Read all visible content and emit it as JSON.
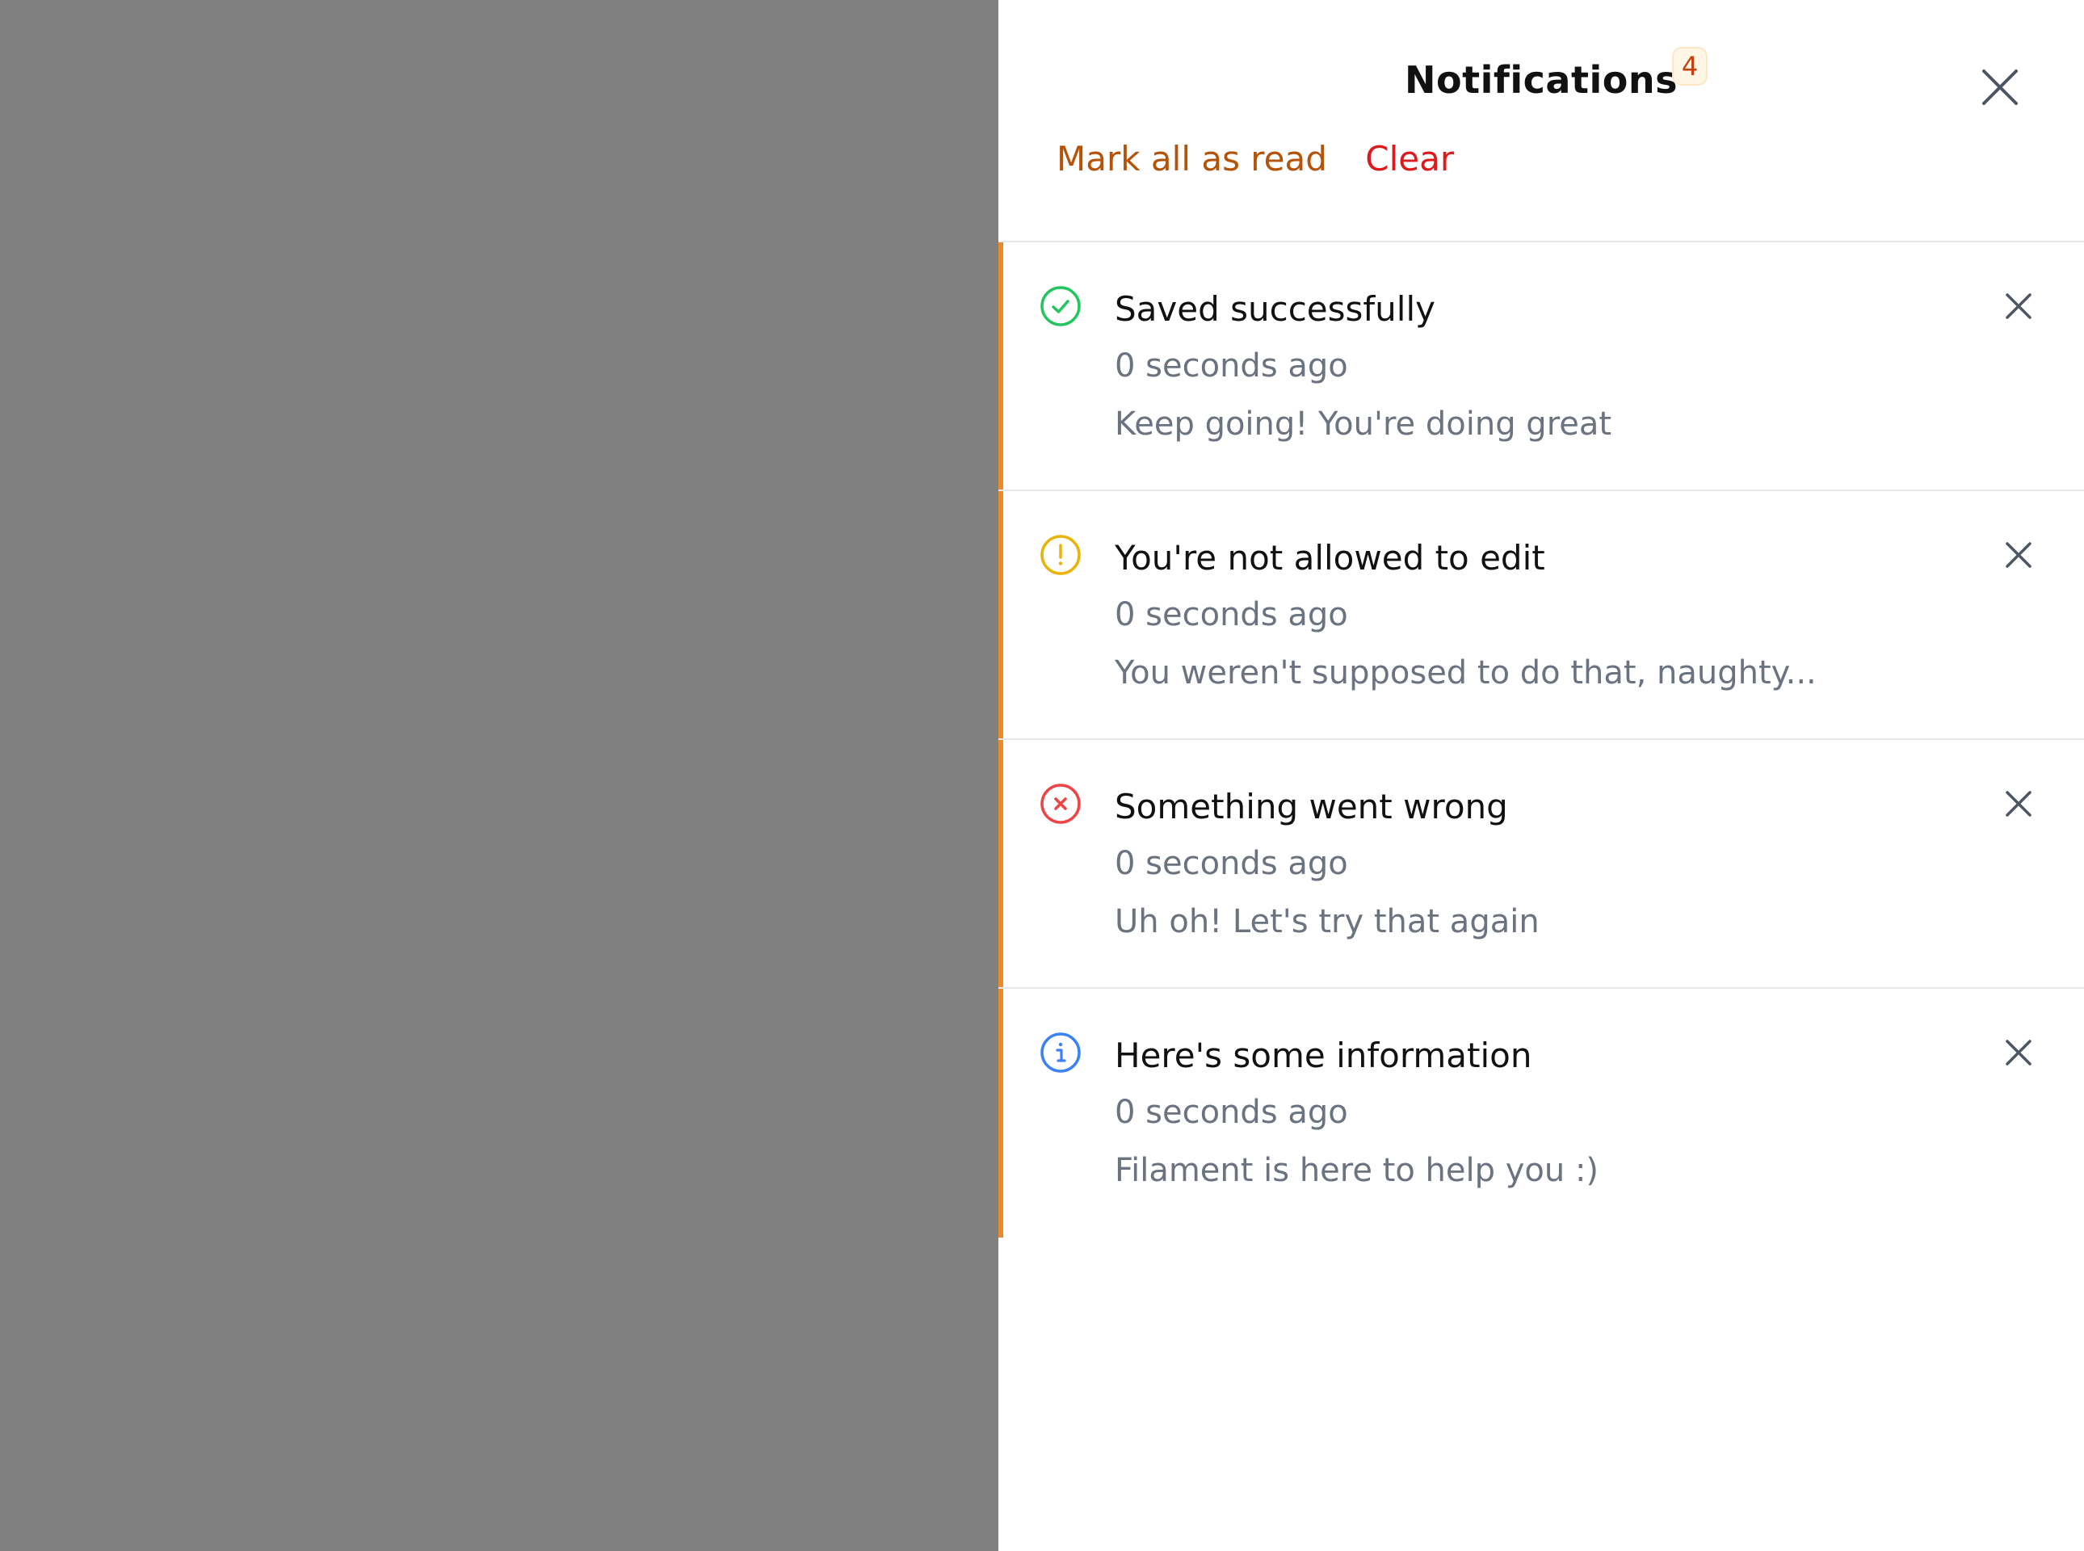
{
  "panel": {
    "title": "Notifications",
    "unread_count": "4",
    "mark_all_read_label": "Mark all as read",
    "clear_label": "Clear"
  },
  "colors": {
    "overlay": "#808080",
    "accent_bar": "#ea8a2b",
    "success": "#22c55e",
    "warning": "#eab308",
    "danger": "#ef4444",
    "info": "#3b82f6",
    "mark_all_read": "#b45309",
    "clear": "#dc1c1c"
  },
  "notifications": [
    {
      "icon": "check-circle-icon",
      "title": "Saved successfully",
      "time": "0 seconds ago",
      "body": "Keep going! You're doing great"
    },
    {
      "icon": "exclamation-circle-icon",
      "title": "You're not allowed to edit",
      "time": "0 seconds ago",
      "body": "You weren't supposed to do that, naughty..."
    },
    {
      "icon": "x-circle-icon",
      "title": "Something went wrong",
      "time": "0 seconds ago",
      "body": "Uh oh! Let's try that again"
    },
    {
      "icon": "info-circle-icon",
      "title": "Here's some information",
      "time": "0 seconds ago",
      "body": "Filament is here to help you :)"
    }
  ]
}
